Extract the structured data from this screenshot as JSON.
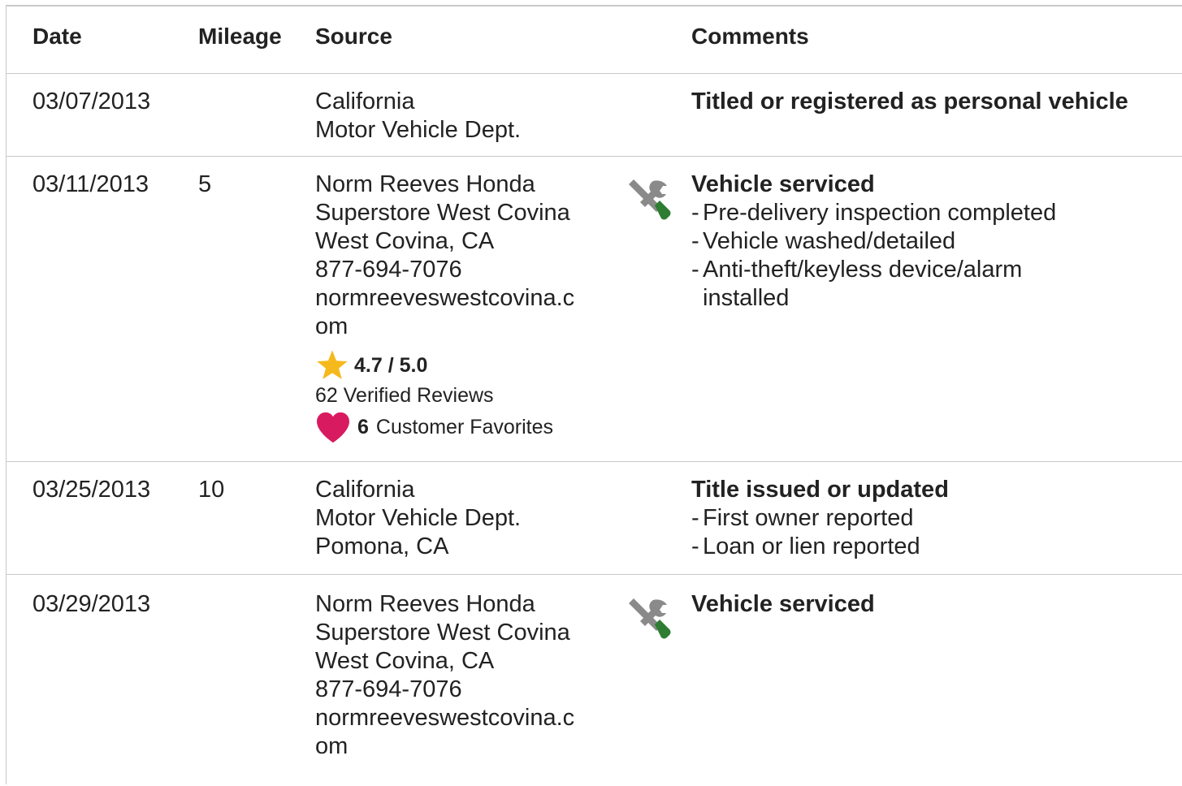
{
  "header": {
    "date": "Date",
    "mileage": "Mileage",
    "source": "Source",
    "comments": "Comments"
  },
  "rows": [
    {
      "date": "03/07/2013",
      "mileage": "",
      "source": [
        "California",
        "Motor Vehicle Dept."
      ],
      "comment_title": "Titled or registered as personal vehicle",
      "comment_items": []
    },
    {
      "date": "03/11/2013",
      "mileage": "5",
      "source": [
        "Norm Reeves Honda",
        "Superstore West Covina",
        "West Covina, CA",
        "877-694-7076",
        "normreeveswestcovina.c",
        "om"
      ],
      "icon": "service-tools-icon",
      "rating": "4.7 / 5.0",
      "reviews": "62 Verified Reviews",
      "favorites_count": "6",
      "favorites_label": "Customer Favorites",
      "comment_title": "Vehicle serviced",
      "comment_items": [
        "Pre-delivery inspection completed",
        "Vehicle washed/detailed",
        "Anti-theft/keyless device/alarm installed"
      ]
    },
    {
      "date": "03/25/2013",
      "mileage": "10",
      "source": [
        "California",
        "Motor Vehicle Dept.",
        "Pomona, CA"
      ],
      "comment_title": "Title issued or updated",
      "comment_items": [
        "First owner reported",
        "Loan or lien reported"
      ]
    },
    {
      "date": "03/29/2013",
      "mileage": "",
      "source": [
        "Norm Reeves Honda",
        "Superstore West Covina",
        "West Covina, CA",
        "877-694-7076",
        "normreeveswestcovina.c",
        "om"
      ],
      "icon": "service-tools-icon",
      "comment_title": "Vehicle serviced",
      "comment_items": []
    }
  ],
  "colors": {
    "star": "#f6b91c",
    "heart": "#d81b60",
    "wrench_gray": "#8a8a8a",
    "screwdriver_green": "#2e7d32",
    "border": "#c8c8c8"
  }
}
